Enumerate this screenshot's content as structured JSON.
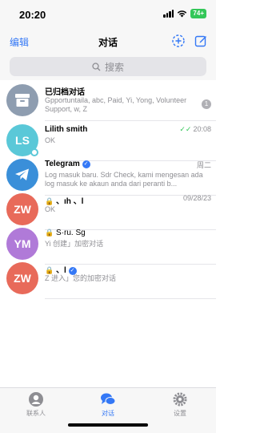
{
  "status_bar": {
    "time": "20:20",
    "battery": "74+"
  },
  "nav": {
    "edit_label": "编辑",
    "title": "对话",
    "new_story_icon": "plus-circle-dashed-icon",
    "compose_icon": "compose-icon"
  },
  "search": {
    "placeholder": "搜索",
    "icon": "search-icon"
  },
  "chats": [
    {
      "avatar_text": "",
      "avatar_icon": "archive-box-icon",
      "avatar_color": "#8e9db0",
      "name": "已归档对话",
      "time": "",
      "preview": "Gpportuntaila, abc, Paid, Yi, Yong, Volunteer Support, w, Z",
      "badge": "1"
    },
    {
      "avatar_text": "LS",
      "avatar_color": "#5ac8d8",
      "name": "Lilith smith",
      "time": "20:08",
      "preview": "OK",
      "read_status": "double-check"
    },
    {
      "avatar_text": "",
      "avatar_icon": "telegram-plane-icon",
      "avatar_color": "#3a8fd9",
      "name": "Telegram",
      "time": "周二",
      "preview": "Log masuk baru. Sdr Check, kami mengesan ada log masuk ke akaun anda dari peranti b..."
    },
    {
      "avatar_text": "ZW",
      "avatar_color": "#e86a5a",
      "name": "、ıh 、l",
      "time": "09/28/23",
      "preview": "OK",
      "secret": true
    },
    {
      "avatar_text": "YM",
      "avatar_color": "#b07ad8",
      "name": "S·ru. Sg",
      "time": "",
      "preview": "Yi 创建」加密对话",
      "secret": true
    },
    {
      "avatar_text": "ZW",
      "avatar_color": "#e86a5a",
      "name": "、l",
      "time": "",
      "preview": "Z 进入」您的加密对话",
      "secret": true
    }
  ],
  "tabbar": {
    "contacts_label": "联系人",
    "chats_label": "对话",
    "settings_label": "设置",
    "active_color": "#3478f6"
  }
}
